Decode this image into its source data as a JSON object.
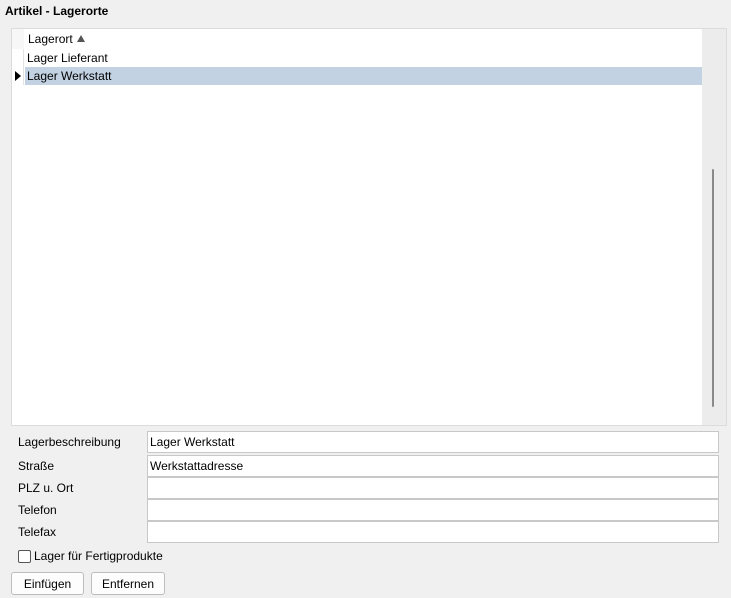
{
  "window": {
    "title": "Artikel - Lagerorte"
  },
  "grid": {
    "column_header": "Lagerort",
    "sort_direction": "ascending",
    "rows": [
      {
        "label": "Lager Lieferant",
        "selected": false
      },
      {
        "label": "Lager Werkstatt",
        "selected": true
      }
    ],
    "selection_color": "#c2d2e2"
  },
  "form": {
    "lagerbeschreibung": {
      "label": "Lagerbeschreibung",
      "value": "Lager Werkstatt"
    },
    "strasse": {
      "label": "Straße",
      "value": "Werkstattadresse"
    },
    "plz_ort": {
      "label": "PLZ u. Ort",
      "value": ""
    },
    "telefon": {
      "label": "Telefon",
      "value": ""
    },
    "telefax": {
      "label": "Telefax",
      "value": ""
    },
    "fertigprodukte": {
      "label": "Lager für Fertigprodukte",
      "checked": false
    }
  },
  "buttons": {
    "einfuegen": "Einfügen",
    "entfernen": "Entfernen"
  }
}
